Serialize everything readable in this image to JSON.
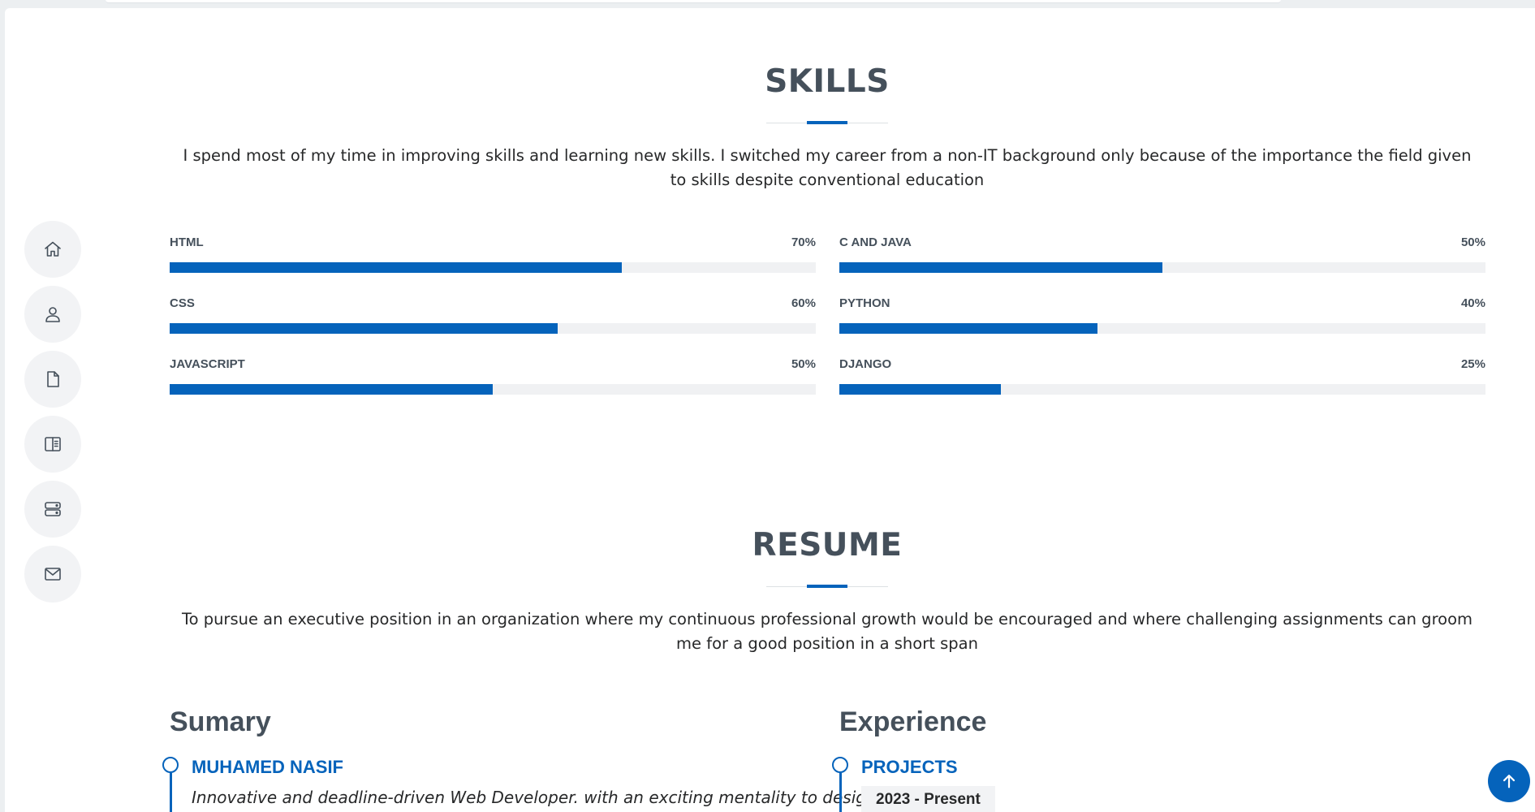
{
  "nav": {
    "items": [
      {
        "icon": "home-icon"
      },
      {
        "icon": "person-icon"
      },
      {
        "icon": "file-icon"
      },
      {
        "icon": "book-icon"
      },
      {
        "icon": "server-icon"
      },
      {
        "icon": "envelope-icon"
      }
    ]
  },
  "skills": {
    "title": "SKILLS",
    "description": "I spend most of my time in improving skills and learning new skills. I switched my career from a non-IT background only because of the importance the field given to skills despite conventional education",
    "left": [
      {
        "name": "HTML",
        "percent_label": "70%",
        "value": 70
      },
      {
        "name": "CSS",
        "percent_label": "60%",
        "value": 60
      },
      {
        "name": "JAVASCRIPT",
        "percent_label": "50%",
        "value": 50
      }
    ],
    "right": [
      {
        "name": "C AND JAVA",
        "percent_label": "50%",
        "value": 50
      },
      {
        "name": "PYTHON",
        "percent_label": "40%",
        "value": 40
      },
      {
        "name": "DJANGO",
        "percent_label": "25%",
        "value": 25
      }
    ],
    "bar_color": "#0563bb"
  },
  "resume": {
    "title": "RESUME",
    "description": "To pursue an executive position in an organization where my continuous professional growth would be encouraged and where challenging assignments can groom me for a good position in a short span",
    "summary": {
      "heading": "Sumary",
      "name": "MUHAMED NASIF",
      "text": "Innovative and deadline-driven Web Developer. with an exciting mentality to design"
    },
    "experience": {
      "heading": "Experience",
      "item_title": "PROJECTS",
      "date": "2023 - Present"
    }
  },
  "back_to_top": {
    "icon": "arrow-up-icon"
  }
}
